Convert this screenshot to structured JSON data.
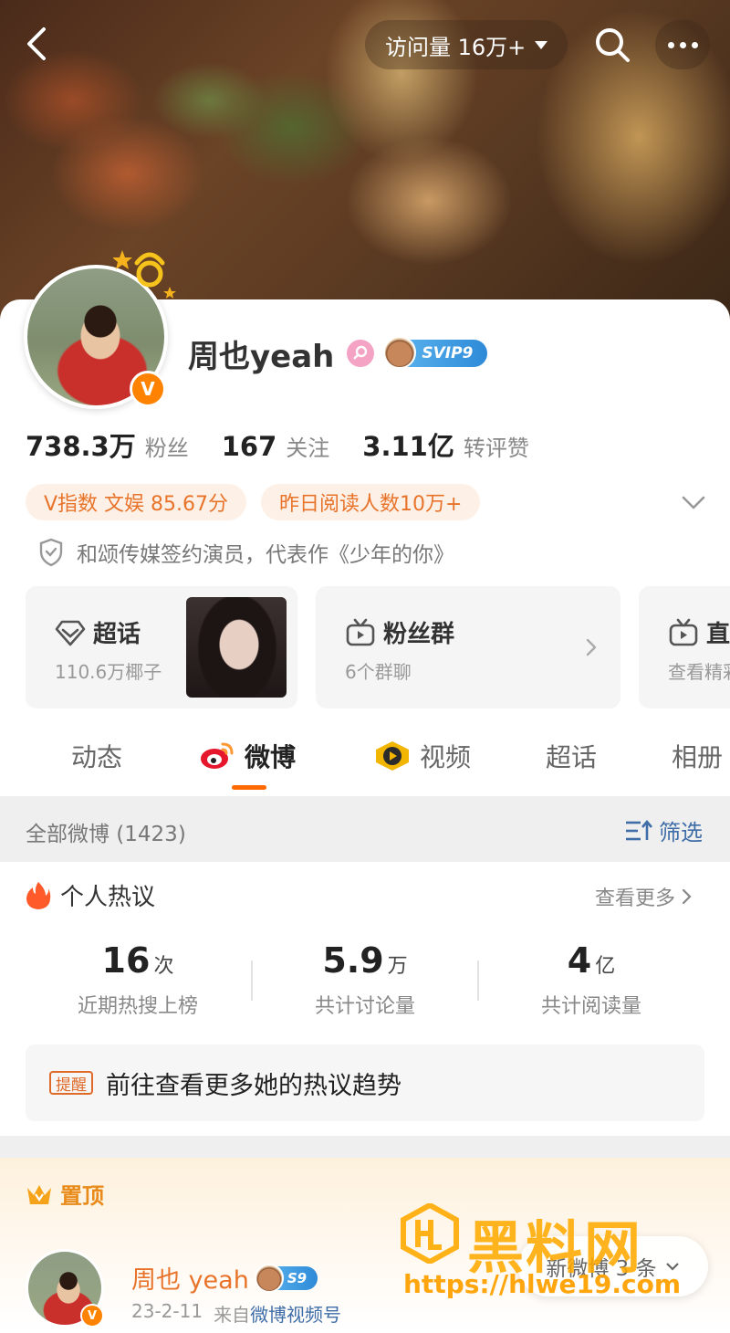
{
  "header": {
    "visits_label": "访问量 16万+"
  },
  "profile": {
    "name": "周也yeah",
    "vip_badge": "SVIP9",
    "verified_mark": "V",
    "stats": [
      {
        "num": "738.3万",
        "label": "粉丝"
      },
      {
        "num": "167",
        "label": "关注"
      },
      {
        "num": "3.11亿",
        "label": "转评赞"
      }
    ],
    "tags": [
      "V指数 文娱 85.67分",
      "昨日阅读人数10万+"
    ],
    "verification": "和颂传媒签约演员，代表作《少年的你》"
  },
  "entries": [
    {
      "title": "超话",
      "sub": "110.6万椰子"
    },
    {
      "title": "粉丝群",
      "sub": "6个群聊"
    },
    {
      "title": "直播",
      "sub": "查看精彩"
    }
  ],
  "tabs": [
    "动态",
    "微博",
    "视频",
    "超话",
    "相册"
  ],
  "active_tab": "微博",
  "filter": {
    "all_label": "全部微博 (1423)",
    "filter_label": "筛选"
  },
  "hot": {
    "title": "个人热议",
    "more": "查看更多",
    "stats": [
      {
        "value": "16",
        "unit": "次",
        "desc": "近期热搜上榜"
      },
      {
        "value": "5.9",
        "unit": "万",
        "desc": "共计讨论量"
      },
      {
        "value": "4",
        "unit": "亿",
        "desc": "共计阅读量"
      }
    ],
    "remind_tag": "提醒",
    "remind_text": "前往查看更多她的热议趋势"
  },
  "pinned": {
    "title": "置顶",
    "post_name": "周也 yeah",
    "post_badge": "S9",
    "date": "23-2-11",
    "from": "来自",
    "source": "微博视频号"
  },
  "new_posts": "新微博 3 条",
  "watermark": {
    "text": "黑料网",
    "url": "https://hlwe19.com"
  },
  "colors": {
    "accent": "#ff6a00",
    "tag_text": "#e8742b",
    "link": "#3e6da8",
    "vip_blue": "#2e8ad8"
  }
}
